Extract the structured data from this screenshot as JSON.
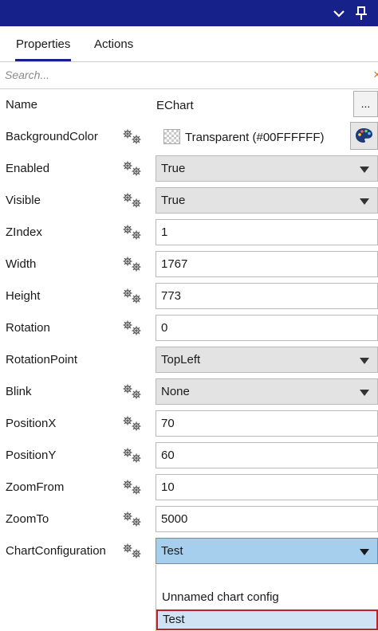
{
  "tabs": [
    {
      "label": "Properties",
      "active": true
    },
    {
      "label": "Actions",
      "active": false
    }
  ],
  "search": {
    "placeholder": "Search...",
    "clear_glyph": "×"
  },
  "icons": {
    "title_bar": [
      "chevron-down-icon",
      "pin-icon"
    ],
    "row": "gears-icon",
    "color_picker": "palette-icon",
    "clear": "close-icon"
  },
  "colors": {
    "title_bar": "#16228a",
    "accent_underline": "#16228a",
    "selected_combo": "#a6cfee",
    "highlight_border": "#c0202a",
    "clear_icon": "#e0701a"
  },
  "properties": {
    "name": {
      "label": "Name",
      "value": "EChart",
      "button": "..."
    },
    "background_color": {
      "label": "BackgroundColor",
      "value": "Transparent (#00FFFFFF)"
    },
    "enabled": {
      "label": "Enabled",
      "value": "True"
    },
    "visible": {
      "label": "Visible",
      "value": "True"
    },
    "zindex": {
      "label": "ZIndex",
      "value": "1"
    },
    "width": {
      "label": "Width",
      "value": "1767"
    },
    "height": {
      "label": "Height",
      "value": "773"
    },
    "rotation": {
      "label": "Rotation",
      "value": "0"
    },
    "rotation_point": {
      "label": "RotationPoint",
      "value": "TopLeft"
    },
    "blink": {
      "label": "Blink",
      "value": "None"
    },
    "position_x": {
      "label": "PositionX",
      "value": "70"
    },
    "position_y": {
      "label": "PositionY",
      "value": "60"
    },
    "zoom_from": {
      "label": "ZoomFrom",
      "value": "10"
    },
    "zoom_to": {
      "label": "ZoomTo",
      "value": "5000"
    },
    "chart_configuration": {
      "label": "ChartConfiguration",
      "value": "Test",
      "options": [
        "",
        "Unnamed chart config",
        "Test"
      ],
      "highlighted_option": "Test"
    }
  }
}
